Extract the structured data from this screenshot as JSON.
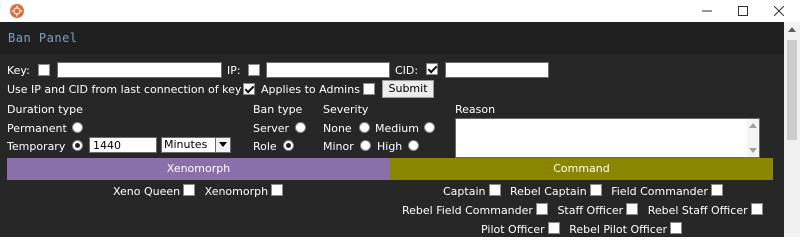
{
  "window": {
    "title": "Ban Panel",
    "controls": [
      "minimize-icon",
      "maximize-icon",
      "close-icon"
    ]
  },
  "row1": {
    "key_label": "Key:",
    "key_checked": false,
    "key_value": "",
    "ip_label": "IP:",
    "ip_checked": false,
    "ip_value": "",
    "cid_label": "CID:",
    "cid_checked": true,
    "cid_value": ""
  },
  "row2": {
    "use_last_label": "Use IP and CID from last connection of key",
    "use_last_checked": true,
    "applies_admins_label": "Applies to Admins",
    "applies_admins_checked": false,
    "submit_label": "Submit"
  },
  "duration": {
    "heading": "Duration type",
    "permanent_label": "Permanent",
    "permanent_selected": false,
    "temporary_label": "Temporary",
    "temporary_selected": true,
    "amount": "1440",
    "unit": "Minutes"
  },
  "ban_type": {
    "heading": "Ban type",
    "server_label": "Server",
    "server_selected": false,
    "role_label": "Role",
    "role_selected": true
  },
  "severity": {
    "heading": "Severity",
    "none_label": "None",
    "medium_label": "Medium",
    "minor_label": "Minor",
    "high_label": "High"
  },
  "reason": {
    "heading": "Reason",
    "value": ""
  },
  "roles": {
    "xeno": {
      "heading": "Xenomorph",
      "color": "#8a70aa",
      "items": [
        "Xeno Queen",
        "Xenomorph"
      ]
    },
    "command": {
      "heading": "Command",
      "color": "#8b8600",
      "rows": [
        [
          "Captain",
          "Rebel Captain",
          "Field Commander"
        ],
        [
          "Rebel Field Commander",
          "Staff Officer",
          "Rebel Staff Officer"
        ],
        [
          "Pilot Officer",
          "Rebel Pilot Officer"
        ]
      ]
    }
  },
  "colors": {
    "panel_bg": "#272727",
    "header_bg": "#202020",
    "title_color": "#7f9fbf",
    "app_icon": "#e06a3c"
  }
}
